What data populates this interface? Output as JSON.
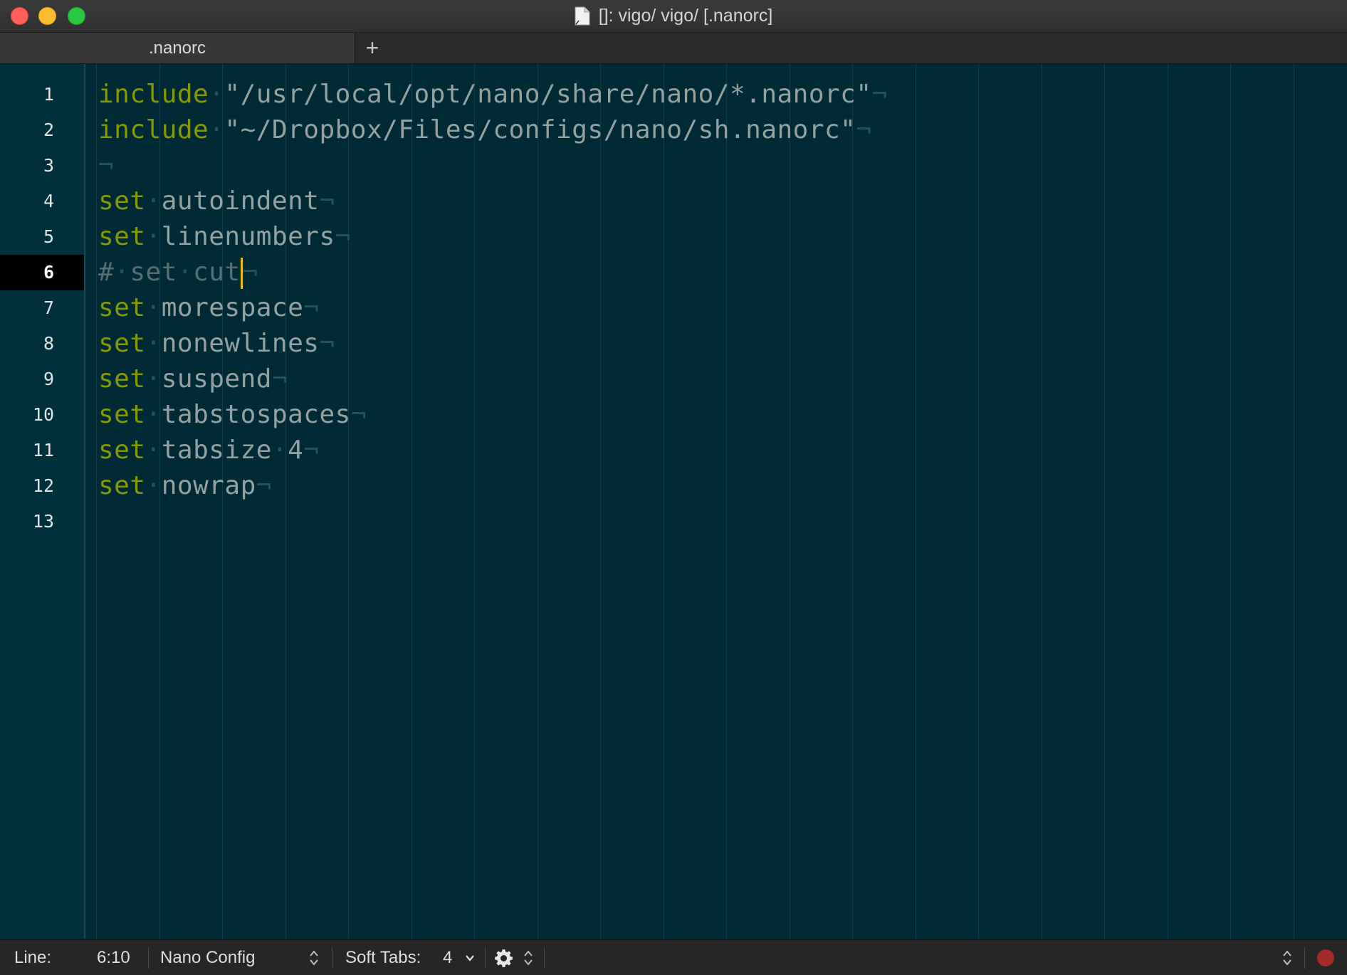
{
  "window": {
    "title": "[]: vigo/ vigo/ [.nanorc]",
    "title_icon": "document-icon"
  },
  "tabs": [
    {
      "label": ".nanorc",
      "active": true
    }
  ],
  "add_tab_label": "+",
  "editor": {
    "current_line": 6,
    "line_numbers": [
      "1",
      "2",
      "3",
      "4",
      "5",
      "6",
      "7",
      "8",
      "9",
      "10",
      "11",
      "12",
      "13"
    ],
    "lines": [
      {
        "kw": "include",
        "rest": "\"/usr/local/opt/nano/share/nano/*.nanorc\""
      },
      {
        "kw": "include",
        "rest": "\"~/Dropbox/Files/configs/nano/sh.nanorc\""
      },
      {
        "kw": "",
        "rest": ""
      },
      {
        "kw": "set",
        "rest": "autoindent"
      },
      {
        "kw": "set",
        "rest": "linenumbers"
      },
      {
        "comment": "# set cut"
      },
      {
        "kw": "set",
        "rest": "morespace"
      },
      {
        "kw": "set",
        "rest": "nonewlines"
      },
      {
        "kw": "set",
        "rest": "suspend"
      },
      {
        "kw": "set",
        "rest": "tabstospaces"
      },
      {
        "kw": "set",
        "rest": "tabsize 4"
      },
      {
        "kw": "set",
        "rest": "nowrap"
      }
    ],
    "colors": {
      "background": "#002b36",
      "keyword": "#859900",
      "text": "#93a1a1",
      "comment": "#586e75",
      "caret": "#e7c500"
    }
  },
  "statusbar": {
    "line_label": "Line:",
    "position": "6:10",
    "language": "Nano Config",
    "soft_tabs_label": "Soft Tabs:",
    "tab_size": "4",
    "settings_icon": "gear-icon",
    "recording_icon": "record-icon"
  }
}
